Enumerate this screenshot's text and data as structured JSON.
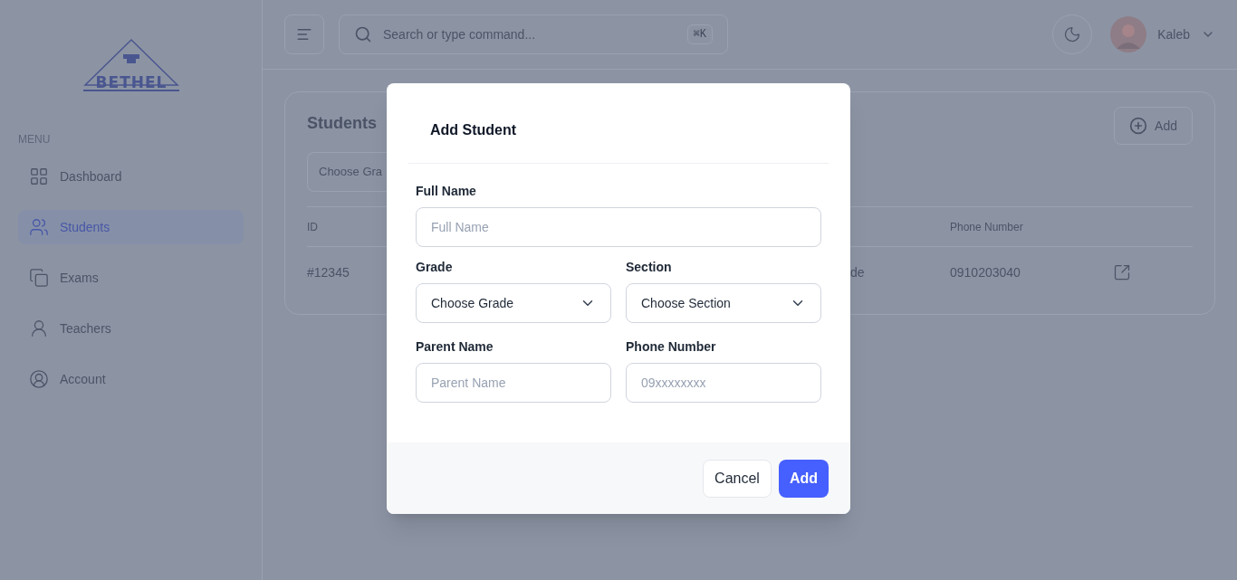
{
  "sidebar": {
    "logo_text": "BETHEL",
    "menu_heading": "MENU",
    "items": [
      {
        "label": "Dashboard",
        "selected": false
      },
      {
        "label": "Students",
        "selected": true
      },
      {
        "label": "Exams",
        "selected": false
      },
      {
        "label": "Teachers",
        "selected": false
      },
      {
        "label": "Account",
        "selected": false
      }
    ]
  },
  "header": {
    "search": {
      "placeholder": "Search or type command...",
      "shortcut": "⌘K"
    },
    "user": {
      "name": "Kaleb"
    }
  },
  "card": {
    "title": "Students",
    "add_button": "Add",
    "grade_filter": "Choose Gra",
    "table": {
      "columns": [
        {
          "label": "ID"
        },
        {
          "label": "Phone Number"
        }
      ],
      "rows": [
        {
          "id": "#12345",
          "column_3": "de",
          "phone": "0910203040"
        }
      ]
    }
  },
  "dialog": {
    "title": "Add Student",
    "fields": [
      {
        "kind": "input",
        "label": "Full Name",
        "placeholder": "Full Name"
      },
      {
        "kind": "select",
        "label": "Grade",
        "value": "Choose Grade"
      },
      {
        "kind": "select",
        "label": "Section",
        "value": "Choose Section"
      },
      {
        "kind": "input",
        "label": "Parent Name",
        "placeholder": "Parent Name"
      },
      {
        "kind": "input",
        "label": "Phone Number",
        "placeholder": "09xxxxxxxx"
      }
    ],
    "buttons": [
      {
        "label": "Cancel",
        "kind": "secondary"
      },
      {
        "label": "Add",
        "kind": "primary"
      }
    ]
  }
}
